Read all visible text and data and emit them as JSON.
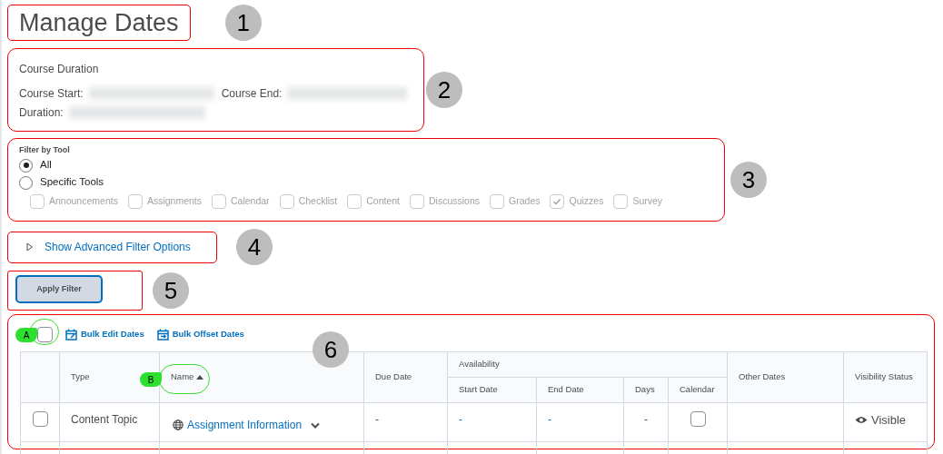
{
  "title": {
    "text": "Manage Dates",
    "marker": "1"
  },
  "course_duration": {
    "marker": "2",
    "heading": "Course Duration",
    "start_label": "Course Start:",
    "end_label": "Course End:",
    "duration_label": "Duration:"
  },
  "filter_by_tool": {
    "marker": "3",
    "heading": "Filter by Tool",
    "options": [
      {
        "label": "All",
        "selected": true
      },
      {
        "label": "Specific Tools",
        "selected": false
      }
    ],
    "tools": [
      {
        "label": "Announcements",
        "checked": false,
        "disabled": true
      },
      {
        "label": "Assignments",
        "checked": false,
        "disabled": true
      },
      {
        "label": "Calendar",
        "checked": false,
        "disabled": true
      },
      {
        "label": "Checklist",
        "checked": false,
        "disabled": true
      },
      {
        "label": "Content",
        "checked": false,
        "disabled": true
      },
      {
        "label": "Discussions",
        "checked": false,
        "disabled": true
      },
      {
        "label": "Grades",
        "checked": false,
        "disabled": true
      },
      {
        "label": "Quizzes",
        "checked": true,
        "disabled": true
      },
      {
        "label": "Survey",
        "checked": false,
        "disabled": true
      }
    ]
  },
  "advanced_filter": {
    "marker": "4",
    "label": "Show Advanced Filter Options",
    "expanded": false
  },
  "apply": {
    "marker": "5",
    "label": "Apply Filter"
  },
  "dates_table": {
    "marker": "6",
    "select_all": {
      "checked": false,
      "callout": "A"
    },
    "actions": [
      {
        "label": "Bulk Edit Dates",
        "kind": "edit"
      },
      {
        "label": "Bulk Offset Dates",
        "kind": "offset"
      }
    ],
    "columns": [
      {
        "label": "Type"
      },
      {
        "label": "Name",
        "sorted": true,
        "callout": "B"
      },
      {
        "label": "Due Date"
      },
      {
        "label": "Availability",
        "children": [
          {
            "label": "Start Date"
          },
          {
            "label": "End Date"
          },
          {
            "label": "Days"
          },
          {
            "label": "Calendar"
          }
        ]
      },
      {
        "label": "Other Dates"
      },
      {
        "label": "Visibility Status"
      }
    ],
    "rows": [
      {
        "selected": false,
        "type": "Content Topic",
        "name": "Assignment Information",
        "due_date": "-",
        "start_date": "-",
        "end_date": "-",
        "days": "-",
        "calendar": false,
        "visibility": "Visible"
      }
    ]
  }
}
